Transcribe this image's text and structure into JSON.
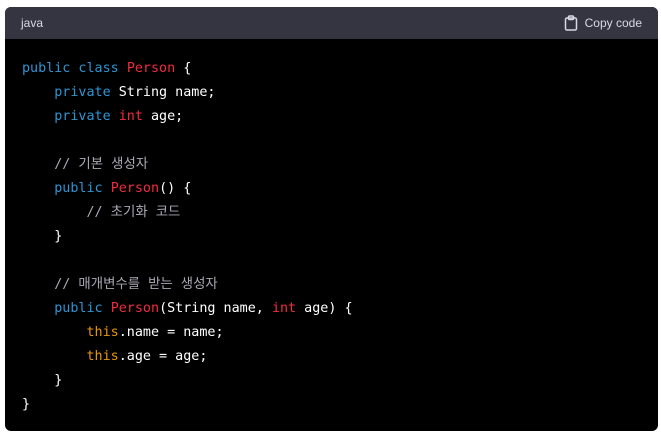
{
  "header": {
    "language": "java",
    "copy_label": "Copy code"
  },
  "code": {
    "lines": [
      [
        {
          "t": "public class ",
          "c": "kw"
        },
        {
          "t": "Person",
          "c": "cls"
        },
        {
          "t": " {",
          "c": "plain"
        }
      ],
      [
        {
          "t": "    ",
          "c": "plain"
        },
        {
          "t": "private",
          "c": "kw"
        },
        {
          "t": " String name;",
          "c": "plain"
        }
      ],
      [
        {
          "t": "    ",
          "c": "plain"
        },
        {
          "t": "private",
          "c": "kw"
        },
        {
          "t": " ",
          "c": "plain"
        },
        {
          "t": "int",
          "c": "type"
        },
        {
          "t": " age;",
          "c": "plain"
        }
      ],
      [],
      [
        {
          "t": "    ",
          "c": "plain"
        },
        {
          "t": "// 기본 생성자",
          "c": "cmt"
        }
      ],
      [
        {
          "t": "    ",
          "c": "plain"
        },
        {
          "t": "public",
          "c": "kw"
        },
        {
          "t": " ",
          "c": "plain"
        },
        {
          "t": "Person",
          "c": "cls"
        },
        {
          "t": "() {",
          "c": "plain"
        }
      ],
      [
        {
          "t": "        ",
          "c": "plain"
        },
        {
          "t": "// 초기화 코드",
          "c": "cmt"
        }
      ],
      [
        {
          "t": "    }",
          "c": "plain"
        }
      ],
      [],
      [
        {
          "t": "    ",
          "c": "plain"
        },
        {
          "t": "// 매개변수를 받는 생성자",
          "c": "cmt"
        }
      ],
      [
        {
          "t": "    ",
          "c": "plain"
        },
        {
          "t": "public",
          "c": "kw"
        },
        {
          "t": " ",
          "c": "plain"
        },
        {
          "t": "Person",
          "c": "cls"
        },
        {
          "t": "(String name, ",
          "c": "plain"
        },
        {
          "t": "int",
          "c": "type"
        },
        {
          "t": " age) {",
          "c": "plain"
        }
      ],
      [
        {
          "t": "        ",
          "c": "plain"
        },
        {
          "t": "this",
          "c": "this"
        },
        {
          "t": ".name = name;",
          "c": "plain"
        }
      ],
      [
        {
          "t": "        ",
          "c": "plain"
        },
        {
          "t": "this",
          "c": "this"
        },
        {
          "t": ".age = age;",
          "c": "plain"
        }
      ],
      [
        {
          "t": "    }",
          "c": "plain"
        }
      ],
      [
        {
          "t": "}",
          "c": "plain"
        }
      ]
    ]
  },
  "colors": {
    "keyword": "#2e95d3",
    "class_name": "#f22c3d",
    "comment": "#a9a9b3",
    "this": "#e9950c",
    "header_bg": "#343541",
    "code_bg": "#000000"
  },
  "icons": {
    "copy": "clipboard-icon"
  }
}
